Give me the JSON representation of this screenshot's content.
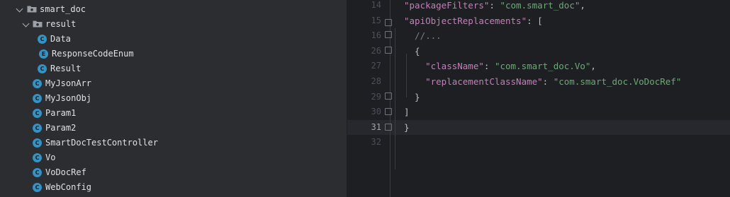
{
  "project_tree": {
    "items": [
      {
        "label": "smart_doc",
        "kind": "folder"
      },
      {
        "label": "result",
        "kind": "folder"
      },
      {
        "label": "Data",
        "kind": "class",
        "badge": "C"
      },
      {
        "label": "ResponseCodeEnum",
        "kind": "enum",
        "badge": "E"
      },
      {
        "label": "Result",
        "kind": "class",
        "badge": "C"
      },
      {
        "label": "MyJsonArr",
        "kind": "class",
        "badge": "C"
      },
      {
        "label": "MyJsonObj",
        "kind": "class",
        "badge": "C"
      },
      {
        "label": "Param1",
        "kind": "class",
        "badge": "C"
      },
      {
        "label": "Param2",
        "kind": "class",
        "badge": "C"
      },
      {
        "label": "SmartDocTestController",
        "kind": "class",
        "badge": "C"
      },
      {
        "label": "Vo",
        "kind": "class",
        "badge": "C"
      },
      {
        "label": "VoDocRef",
        "kind": "class",
        "badge": "C"
      },
      {
        "label": "WebConfig",
        "kind": "class",
        "badge": "C"
      }
    ]
  },
  "editor": {
    "current_line": "31",
    "lines": [
      {
        "num": "14",
        "tokens": [
          {
            "t": "\"packageFilters\"",
            "c": "k"
          },
          {
            "t": ": ",
            "c": "p"
          },
          {
            "t": "\"com.smart_doc\"",
            "c": "s"
          },
          {
            "t": ",",
            "c": "p"
          }
        ]
      },
      {
        "num": "15",
        "tokens": [
          {
            "t": "\"apiObjectReplacements\"",
            "c": "k"
          },
          {
            "t": ": [",
            "c": "p"
          }
        ]
      },
      {
        "num": "16",
        "tokens": [
          {
            "t": "  //...",
            "c": "cm"
          }
        ]
      },
      {
        "num": "26",
        "tokens": [
          {
            "t": "  {",
            "c": "p"
          }
        ]
      },
      {
        "num": "27",
        "tokens": [
          {
            "t": "    \"className\"",
            "c": "k"
          },
          {
            "t": ": ",
            "c": "p"
          },
          {
            "t": "\"com.smart_doc.Vo\"",
            "c": "s"
          },
          {
            "t": ",",
            "c": "p"
          }
        ]
      },
      {
        "num": "28",
        "tokens": [
          {
            "t": "    \"replacementClassName\"",
            "c": "k"
          },
          {
            "t": ": ",
            "c": "p"
          },
          {
            "t": "\"com.smart_doc.VoDocRef\"",
            "c": "s"
          }
        ]
      },
      {
        "num": "29",
        "tokens": [
          {
            "t": "  }",
            "c": "p"
          }
        ]
      },
      {
        "num": "30",
        "tokens": [
          {
            "t": "]",
            "c": "p"
          }
        ]
      },
      {
        "num": "31",
        "tokens": [
          {
            "t": "}",
            "c": "p"
          }
        ]
      },
      {
        "num": "32",
        "tokens": []
      }
    ]
  }
}
